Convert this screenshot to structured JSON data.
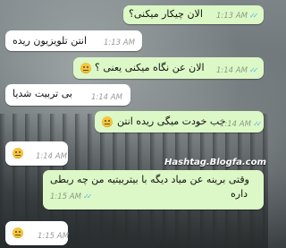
{
  "messages": [
    {
      "dir": "out",
      "text": "الان چیکار میکنی؟",
      "time": "1:13 AM",
      "ticks": "✓✓"
    },
    {
      "dir": "in",
      "text": "انتن تلویزیون ریده",
      "time": "1:13 AM"
    },
    {
      "dir": "out",
      "text": "الان عن نگاه میکنی یعنی ؟",
      "time": "1:14 AM",
      "ticks": "✓✓"
    },
    {
      "dir": "in",
      "text": "بی تربیت شدیا",
      "time": "1:14 AM"
    },
    {
      "dir": "out",
      "text": "خب خودت میگی ریده انتن",
      "time": "1:14 AM",
      "ticks": "✓✓"
    },
    {
      "dir": "in",
      "text": "",
      "time": "1:14 AM"
    },
    {
      "dir": "out",
      "text_line1": "وقتی برینه عن میاد دیگه با بیتربیتیه من چه ربطی",
      "text_line2": "داره",
      "time": "1:15 AM",
      "ticks": "✓✓"
    },
    {
      "dir": "in",
      "text": "",
      "time": "1:15 AM"
    }
  ],
  "watermark": "Hashtag.Blogfa.com",
  "colors": {
    "outgoing": "#dcf8c6",
    "incoming": "#ffffff",
    "ticks": "#56b7e6"
  },
  "icons": [
    "smiley-emoji-icon",
    "double-check-icon"
  ]
}
